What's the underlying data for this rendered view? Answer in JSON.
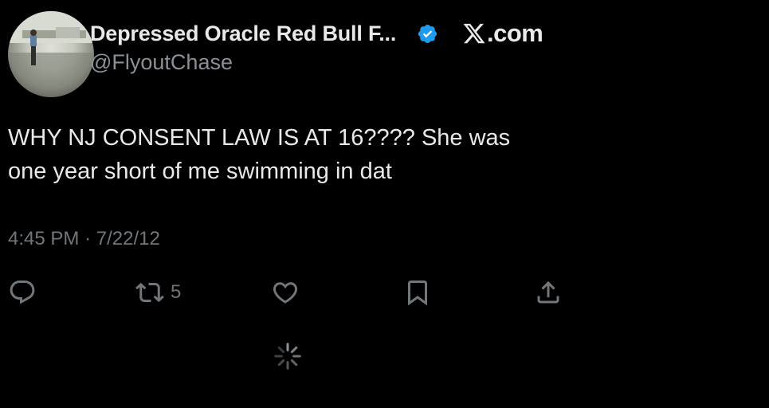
{
  "header": {
    "display_name": "Depressed Oracle Red Bull F...",
    "handle": "@FlyoutChase",
    "brand_suffix": ".com",
    "icons": {
      "avatar": "profile-photo",
      "verified": "verified-badge-icon",
      "brand": "x-logo-icon"
    },
    "verified_color": "#1d9bf0"
  },
  "tweet": {
    "lines": [
      "WHY NJ CONSENT LAW IS AT 16???? She was",
      "one year short of me swimming in dat"
    ],
    "time": "4:45 PM",
    "separator": "·",
    "date": "7/22/12"
  },
  "actions": [
    {
      "name": "reply",
      "icon": "reply-icon",
      "count": ""
    },
    {
      "name": "retweet",
      "icon": "retweet-icon",
      "count": "5"
    },
    {
      "name": "like",
      "icon": "heart-icon",
      "count": ""
    },
    {
      "name": "bookmark",
      "icon": "bookmark-icon",
      "count": ""
    },
    {
      "name": "share",
      "icon": "share-icon",
      "count": ""
    }
  ],
  "loading": {
    "icon": "loading-spinner-icon"
  },
  "colors": {
    "background": "#000000",
    "primary_text": "#e7e9ea",
    "secondary_text": "#71767b",
    "accent": "#1d9bf0"
  }
}
